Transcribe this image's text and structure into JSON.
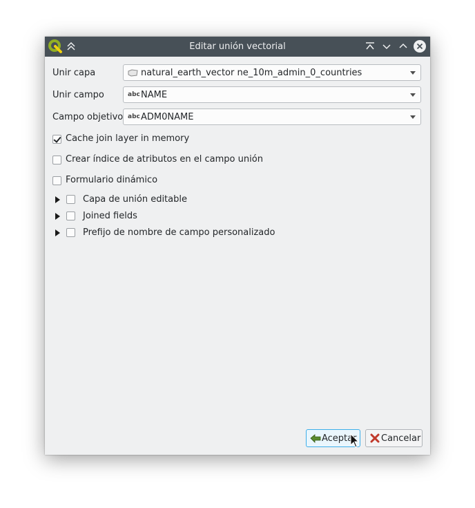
{
  "window": {
    "title": "Editar unión vectorial"
  },
  "form": {
    "join_layer": {
      "label": "Unir capa",
      "value": "natural_earth_vector ne_10m_admin_0_countries",
      "icon": "polygon-layer-icon"
    },
    "join_field": {
      "label": "Unir campo",
      "value": "NAME",
      "type_badge": "abc"
    },
    "target_field": {
      "label": "Campo objetivo",
      "value": "ADM0NAME",
      "type_badge": "abc"
    }
  },
  "options": [
    {
      "label": "Cache join layer in memory",
      "checked": true
    },
    {
      "label": "Crear índice de atributos en el campo unión",
      "checked": false
    },
    {
      "label": "Formulario dinámico",
      "checked": false
    }
  ],
  "groups": [
    {
      "label": "Capa de unión editable",
      "checked": false
    },
    {
      "label": "Joined fields",
      "checked": false
    },
    {
      "label": "Prefijo de nombre de campo personalizado",
      "checked": false
    }
  ],
  "buttons": {
    "ok": "Aceptar",
    "cancel": "Cancelar"
  },
  "colors": {
    "titlebar": "#475057",
    "window_bg": "#eff0f1",
    "focus": "#3daee9"
  }
}
